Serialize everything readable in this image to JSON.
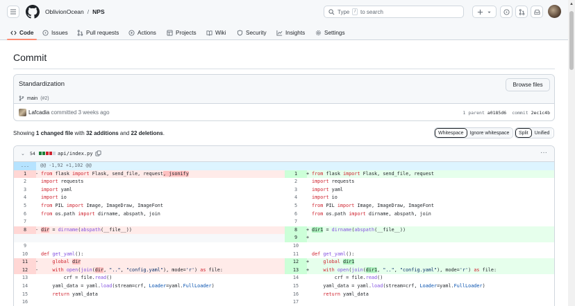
{
  "header": {
    "owner": "OblivionOcean",
    "separator": "/",
    "repo": "NPS",
    "search_prefix": "Type",
    "search_key": "/",
    "search_suffix": "to search"
  },
  "nav": {
    "tabs": [
      {
        "label": "Code"
      },
      {
        "label": "Issues"
      },
      {
        "label": "Pull requests"
      },
      {
        "label": "Actions"
      },
      {
        "label": "Projects"
      },
      {
        "label": "Wiki"
      },
      {
        "label": "Security"
      },
      {
        "label": "Insights"
      },
      {
        "label": "Settings"
      }
    ]
  },
  "page": {
    "title": "Commit"
  },
  "commit": {
    "message": "Standardization",
    "browse_label": "Browse files",
    "branch": "main",
    "pr": "(#2)",
    "author": "Lafcadia",
    "authored": "committed 3 weeks ago",
    "parent_label": "1 parent",
    "parent_sha": "a0185d6",
    "commit_label": "commit",
    "commit_sha": "2ec1c4b"
  },
  "summary": {
    "prefix": "Showing",
    "changed": "1 changed file",
    "with": "with",
    "additions": "32 additions",
    "and": "and",
    "deletions": "22 deletions",
    "end": "."
  },
  "view_toggle": {
    "whitespace": "Whitespace",
    "ignore": "Ignore whitespace",
    "split": "Split",
    "unified": "Unified"
  },
  "file": {
    "count": "54",
    "path": "api/index.py",
    "hunk": "@@ -1,92 +1,102 @@",
    "expand": "...",
    "colors": {
      "added": "#1a7f37",
      "deleted": "#cf222e",
      "neutral": "#d0d7de"
    }
  },
  "diff": {
    "left": [
      {
        "n": "1",
        "s": "-",
        "type": "del"
      },
      {
        "n": "2",
        "s": "",
        "type": "ctx"
      },
      {
        "n": "3",
        "s": "",
        "type": "ctx"
      },
      {
        "n": "4",
        "s": "",
        "type": "ctx"
      },
      {
        "n": "5",
        "s": "",
        "type": "ctx"
      },
      {
        "n": "6",
        "s": "",
        "type": "ctx"
      },
      {
        "n": "7",
        "s": "",
        "type": "ctx"
      },
      {
        "n": "8",
        "s": "-",
        "type": "del"
      },
      {
        "n": "",
        "s": "",
        "type": "empty"
      },
      {
        "n": "9",
        "s": "",
        "type": "ctx"
      },
      {
        "n": "10",
        "s": "",
        "type": "ctx"
      },
      {
        "n": "11",
        "s": "-",
        "type": "del"
      },
      {
        "n": "12",
        "s": "-",
        "type": "del"
      },
      {
        "n": "13",
        "s": "",
        "type": "ctx"
      },
      {
        "n": "14",
        "s": "",
        "type": "ctx"
      },
      {
        "n": "15",
        "s": "",
        "type": "ctx"
      },
      {
        "n": "16",
        "s": "",
        "type": "ctx"
      }
    ],
    "right": [
      {
        "n": "1",
        "s": "+",
        "type": "add"
      },
      {
        "n": "2",
        "s": "",
        "type": "ctx"
      },
      {
        "n": "3",
        "s": "",
        "type": "ctx"
      },
      {
        "n": "4",
        "s": "",
        "type": "ctx"
      },
      {
        "n": "5",
        "s": "",
        "type": "ctx"
      },
      {
        "n": "6",
        "s": "",
        "type": "ctx"
      },
      {
        "n": "7",
        "s": "",
        "type": "ctx"
      },
      {
        "n": "8",
        "s": "+",
        "type": "add"
      },
      {
        "n": "9",
        "s": "+",
        "type": "add"
      },
      {
        "n": "10",
        "s": "",
        "type": "ctx"
      },
      {
        "n": "11",
        "s": "",
        "type": "ctx"
      },
      {
        "n": "12",
        "s": "+",
        "type": "add"
      },
      {
        "n": "13",
        "s": "+",
        "type": "add"
      },
      {
        "n": "14",
        "s": "",
        "type": "ctx"
      },
      {
        "n": "15",
        "s": "",
        "type": "ctx"
      },
      {
        "n": "16",
        "s": "",
        "type": "ctx"
      },
      {
        "n": "17",
        "s": "",
        "type": "ctx"
      }
    ],
    "code": {
      "l1a": "from",
      "l1b": " flask ",
      "l1c": "import",
      "l1d": " Flask, send_file, request",
      "l1e": ", jsonify",
      "r1a": "from",
      "r1b": " flask ",
      "r1c": "import",
      "r1d": " Flask, send_file, request",
      "i1a": "import",
      "i1b": " requests",
      "i2a": "import",
      "i2b": " yaml",
      "i3a": "import",
      "i3b": " io",
      "p1a": "from",
      "p1b": " PIL ",
      "p1c": "import",
      "p1d": " Image, ImageDraw, ImageFont",
      "o1a": "from",
      "o1b": " os.path ",
      "o1c": "import",
      "o1d": " dirname, abspath, join",
      "l8a": "dir",
      "l8b": " = ",
      "l8c": "dirname",
      "l8d": "(",
      "l8e": "abspath",
      "l8f": "(__file__))",
      "r8a": "dir1",
      "r8b": " = ",
      "r8c": "dirname",
      "r8d": "(",
      "r8e": "abspath",
      "r8f": "(__file__))",
      "g1a": "def",
      "g1b": " ",
      "g1c": "get_yaml",
      "g1d": "():",
      "l11a": "    ",
      "l11b": "global",
      "l11c": " ",
      "l11d": "dir",
      "r12a": "    ",
      "r12b": "global",
      "r12c": " ",
      "r12d": "dir1",
      "l12a": "    ",
      "l12b": "with",
      "l12c": " ",
      "l12d": "open",
      "l12e": "(",
      "l12f": "join",
      "l12g": "(",
      "l12h": "dir",
      "l12i": ", ",
      "l12j": "\"..\"",
      "l12k": ", ",
      "l12l": "\"config.yaml\"",
      "l12m": "), mode=",
      "l12n": "'r'",
      "l12o": ") ",
      "l12p": "as",
      "l12q": " file:",
      "r13h": "dir1",
      "c1a": "        crf = file.",
      "c1b": "read",
      "c1c": "()",
      "y1a": "    yaml_data = yaml.",
      "y1b": "load",
      "y1c": "(stream=crf, ",
      "y1d": "Loader",
      "y1e": "=yaml.",
      "y1f": "FullLoader",
      "y1g": ")",
      "rt1a": "    ",
      "rt1b": "return",
      "rt1c": " yaml_data"
    }
  }
}
